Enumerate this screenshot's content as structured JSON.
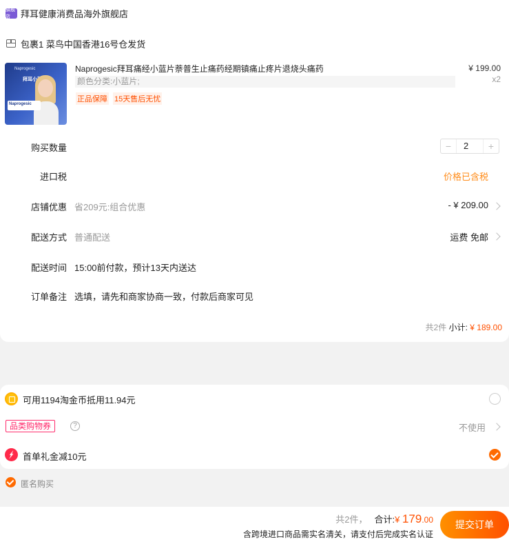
{
  "shop": {
    "logo_text": "旗舰店",
    "name": "拜耳健康消费品海外旗舰店"
  },
  "package": {
    "label": "包裹1 菜鸟中国香港16号仓发货"
  },
  "product": {
    "image": {
      "brand": "Naprogesic",
      "tag": "拜耳小蓝片",
      "box_text": "Naprogesic"
    },
    "title": "Naprogesic拜耳痛经小蓝片萘普生止痛药经期镇痛止疼片退烧头痛药",
    "spec": "颜色分类:小蓝片;",
    "badges": [
      "正品保障",
      "15天售后无忧"
    ],
    "price": "¥ 199.00",
    "quantity_x": "x2"
  },
  "rows": {
    "quantity": {
      "label": "购买数量",
      "value": "2",
      "minus": "−",
      "plus": "+"
    },
    "tax": {
      "label": "进口税",
      "value": "价格已含税"
    },
    "promo": {
      "label": "店铺优惠",
      "desc": "省209元:组合优惠",
      "value": "- ¥ 209.00"
    },
    "delivery": {
      "label": "配送方式",
      "desc": "普通配送",
      "value": "运费 免邮"
    },
    "time": {
      "label": "配送时间",
      "desc": "15:00前付款，预计13天内送达"
    },
    "note": {
      "label": "订单备注",
      "placeholder": "选填，请先和商家协商一致，付款后商家可见"
    }
  },
  "subtotal": {
    "count": "共2件",
    "label": "小计:",
    "amount": "¥ 189.00"
  },
  "discounts": {
    "coins": "可用1194淘金币抵用11.94元",
    "coupon_tag": "品类购物券",
    "help": "?",
    "coupon_value": "不使用",
    "first_order": "首单礼金减10元"
  },
  "anonymous": {
    "label": "匿名购买"
  },
  "footer": {
    "count": "共2件，",
    "total_label": "合计:",
    "currency": "¥ ",
    "total_int": "179",
    "total_dec": ".00",
    "notice": "含跨境进口商品需实名清关，请支付后完成实名认证",
    "submit": "提交订单"
  },
  "colors": {
    "accent": "#ff5000",
    "tax": "#ff8c1a",
    "coupon": "#ff2a6b",
    "shop_logo": "#7b5bd6"
  }
}
